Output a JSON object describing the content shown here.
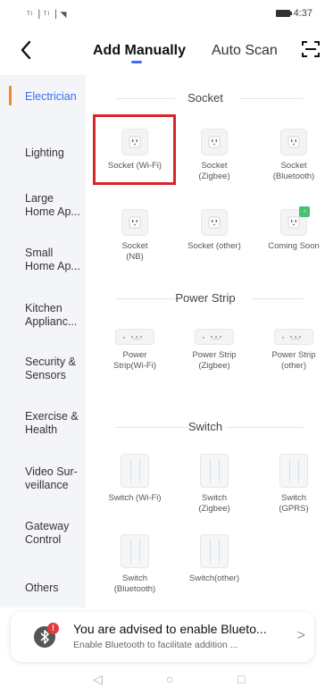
{
  "status": {
    "signal": "ᵀˡ▕ ᵀˡ▕ ◥",
    "time": "4:37"
  },
  "nav": {
    "tab_manual": "Add Manually",
    "tab_auto": "Auto Scan",
    "accent_color": "#3b6ef5"
  },
  "sidebar": {
    "items": [
      {
        "label": "Electrician"
      },
      {
        "label": "Lighting"
      },
      {
        "label": "Large\nHome Ap..."
      },
      {
        "label": "Small\nHome Ap..."
      },
      {
        "label": "Kitchen\nApplianc..."
      },
      {
        "label": "Security &\nSensors"
      },
      {
        "label": "Exercise &\nHealth"
      },
      {
        "label": "Video Sur-\nveillance"
      },
      {
        "label": "Gateway\nControl"
      },
      {
        "label": "Others"
      }
    ]
  },
  "sections": {
    "socket": {
      "title": "Socket",
      "items": [
        {
          "label": "Socket (Wi-Fi)"
        },
        {
          "label": "Socket\n(Zigbee)"
        },
        {
          "label": "Socket\n(Bluetooth)"
        },
        {
          "label": "Socket\n(NB)"
        },
        {
          "label": "Socket (other)"
        },
        {
          "label": "Coming Soon"
        }
      ]
    },
    "power_strip": {
      "title": "Power Strip",
      "items": [
        {
          "label": "Power\nStrip(Wi-Fi)"
        },
        {
          "label": "Power Strip\n(Zigbee)"
        },
        {
          "label": "Power Strip\n(other)"
        }
      ]
    },
    "switch": {
      "title": "Switch",
      "items": [
        {
          "label": "Switch (Wi-Fi)"
        },
        {
          "label": "Switch\n(Zigbee)"
        },
        {
          "label": "Switch\n(GPRS)"
        },
        {
          "label": "Switch\n(Bluetooth)"
        },
        {
          "label": "Switch(other)"
        }
      ]
    }
  },
  "banner": {
    "badge": "!",
    "title": "You are advised to enable Blueto...",
    "subtitle": "Enable Bluetooth to facilitate addition ...",
    "arrow": ">"
  },
  "navbar": {
    "back": "◁",
    "home": "○",
    "recents": "□"
  }
}
